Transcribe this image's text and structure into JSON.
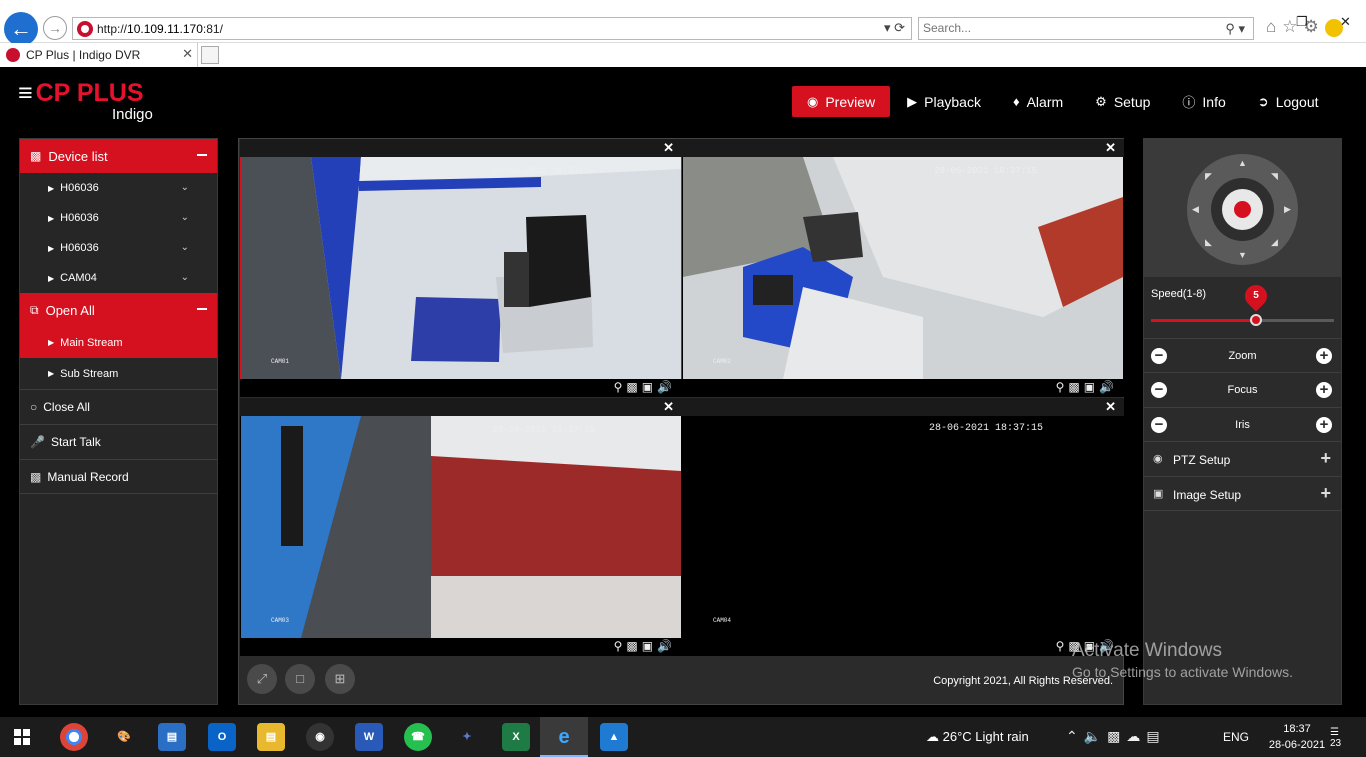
{
  "browser": {
    "url_prefix": "http://",
    "url_host": "10.109.11.170",
    "url_port": ":81/",
    "search_placeholder": "Search...",
    "tab_title": "CP Plus | Indigo DVR"
  },
  "brand": {
    "name": "CP PLUS",
    "sub": "Indigo"
  },
  "nav": [
    {
      "label": "Preview",
      "icon": "eye-icon",
      "active": true
    },
    {
      "label": "Playback",
      "icon": "play-icon"
    },
    {
      "label": "Alarm",
      "icon": "bell-icon"
    },
    {
      "label": "Setup",
      "icon": "gear-icon"
    },
    {
      "label": "Info",
      "icon": "info-icon"
    },
    {
      "label": "Logout",
      "icon": "logout-icon"
    }
  ],
  "left_panel": {
    "device_list_label": "Device list",
    "devices": [
      "H06036",
      "H06036",
      "H06036",
      "CAM04"
    ],
    "open_all_label": "Open All",
    "streams": [
      {
        "label": "Main Stream",
        "active": true
      },
      {
        "label": "Sub Stream"
      }
    ],
    "close_all_label": "Close All",
    "start_talk_label": "Start Talk",
    "manual_record_label": "Manual Record"
  },
  "tiles": [
    {
      "timestamp": "28-06-2021 18:37:15",
      "label": "CAM01",
      "selected": true
    },
    {
      "timestamp": "28-06-2021 18:37:15",
      "label": "CAM02"
    },
    {
      "timestamp": "28-06-2021 18:37:15",
      "label": "CAM03"
    },
    {
      "timestamp": "28-06-2021 18:37:15",
      "label": "CAM04"
    }
  ],
  "copyright": "Copyright 2021, All Rights Reserved.",
  "right_panel": {
    "speed_label": "Speed(1-8)",
    "speed_value": "5",
    "speed_min": 1,
    "speed_max": 8,
    "zoom_label": "Zoom",
    "focus_label": "Focus",
    "iris_label": "Iris",
    "ptz_setup_label": "PTZ Setup",
    "image_setup_label": "Image Setup"
  },
  "watermark": {
    "line1": "Activate Windows",
    "line2": "Go to Settings to activate Windows."
  },
  "taskbar": {
    "weather": "26°C  Light rain",
    "lang": "ENG",
    "time": "18:37",
    "date": "28-06-2021",
    "notifications": "23"
  },
  "colors": {
    "accent": "#d6111f",
    "panel": "#262626",
    "bg": "#000000"
  }
}
